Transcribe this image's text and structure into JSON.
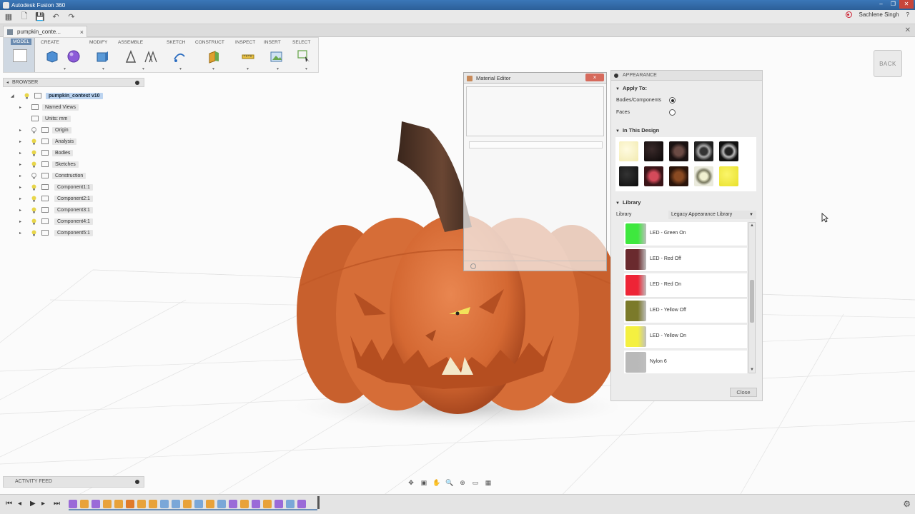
{
  "window": {
    "title": "Autodesk Fusion 360"
  },
  "header": {
    "user": "Sachlene Singh",
    "help": "?"
  },
  "tab": {
    "name": "pumpkin_conte...",
    "close": "×"
  },
  "toolbar": {
    "model": "MODEL",
    "groups": [
      "CREATE",
      "MODIFY",
      "ASSEMBLE",
      "SKETCH",
      "CONSTRUCT",
      "INSPECT",
      "INSERT",
      "SELECT"
    ]
  },
  "browser": {
    "title": "BROWSER",
    "items": [
      "pumpkin_contest v10",
      "Named Views",
      "Units: mm",
      "Origin",
      "Analysis",
      "Bodies",
      "Sketches",
      "Construction",
      "Component1:1",
      "Component2:1",
      "Component3:1",
      "Component4:1",
      "Component5:1"
    ]
  },
  "viewcube": {
    "label": "BACK"
  },
  "material_editor": {
    "title": "Material Editor",
    "close": "×"
  },
  "appearance": {
    "title": "APPEARANCE",
    "apply_to": "Apply To:",
    "bodies": "Bodies/Components",
    "faces": "Faces",
    "in_design": "In This Design",
    "library_section": "Library",
    "library_label": "Library",
    "library_value": "Legacy Appearance Library",
    "items": [
      {
        "name": "LED - Green On",
        "color": "#3ee83e"
      },
      {
        "name": "LED - Red Off",
        "color": "#6a2a2e"
      },
      {
        "name": "LED - Red On",
        "color": "#ee2436"
      },
      {
        "name": "LED - Yellow Off",
        "color": "#7b7a2a"
      },
      {
        "name": "LED - Yellow On",
        "color": "#f4f040"
      },
      {
        "name": "Nylon 6",
        "color": "#b9b9b9"
      }
    ],
    "close": "Close"
  },
  "activity": {
    "title": "ACTIVITY FEED"
  },
  "colors": {
    "pumpkin": "#d9703a",
    "stem": "#5a3a2a",
    "accent": "#3b77b8"
  }
}
